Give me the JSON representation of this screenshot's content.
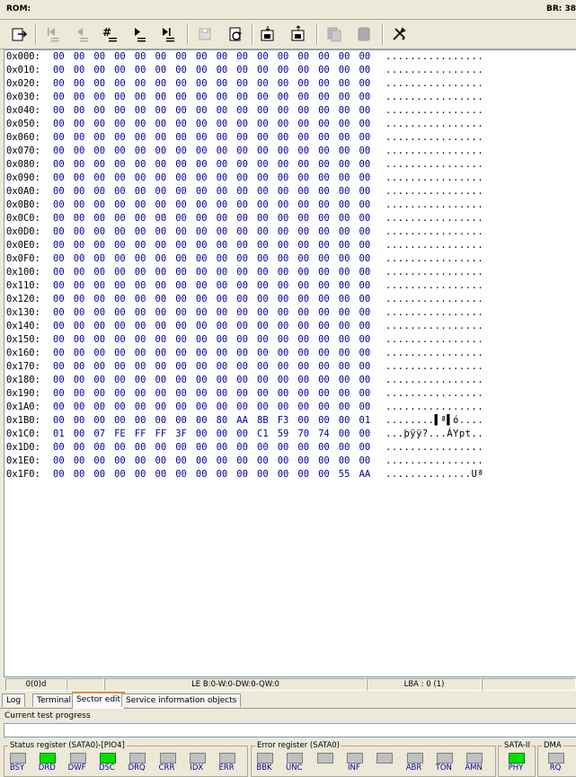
{
  "title_bar": {
    "rom_label": "ROM:",
    "br_label": "BR: 38"
  },
  "toolbar": {
    "buttons": [
      {
        "name": "export-icon",
        "enabled": true
      },
      {
        "name": "first-sector-icon",
        "enabled": false
      },
      {
        "name": "prev-sector-icon",
        "enabled": false
      },
      {
        "name": "goto-sector-icon",
        "enabled": true
      },
      {
        "name": "next-sector-icon",
        "enabled": true
      },
      {
        "name": "last-sector-icon",
        "enabled": true
      },
      {
        "name": "save-icon",
        "enabled": false
      },
      {
        "name": "refresh-icon",
        "enabled": true
      },
      {
        "name": "load-file-icon",
        "enabled": true
      },
      {
        "name": "save-file-icon",
        "enabled": true
      },
      {
        "name": "copy-icon",
        "enabled": false
      },
      {
        "name": "paste-icon",
        "enabled": false
      },
      {
        "name": "tools-icon",
        "enabled": true
      }
    ]
  },
  "hex_rows": [
    {
      "addr": "0x000:",
      "bytes": [
        "00",
        "00",
        "00",
        "00",
        "00",
        "00",
        "00",
        "00",
        "00",
        "00",
        "00",
        "00",
        "00",
        "00",
        "00",
        "00"
      ],
      "ascii": "................"
    },
    {
      "addr": "0x010:",
      "bytes": [
        "00",
        "00",
        "00",
        "00",
        "00",
        "00",
        "00",
        "00",
        "00",
        "00",
        "00",
        "00",
        "00",
        "00",
        "00",
        "00"
      ],
      "ascii": "................"
    },
    {
      "addr": "0x020:",
      "bytes": [
        "00",
        "00",
        "00",
        "00",
        "00",
        "00",
        "00",
        "00",
        "00",
        "00",
        "00",
        "00",
        "00",
        "00",
        "00",
        "00"
      ],
      "ascii": "................"
    },
    {
      "addr": "0x030:",
      "bytes": [
        "00",
        "00",
        "00",
        "00",
        "00",
        "00",
        "00",
        "00",
        "00",
        "00",
        "00",
        "00",
        "00",
        "00",
        "00",
        "00"
      ],
      "ascii": "................"
    },
    {
      "addr": "0x040:",
      "bytes": [
        "00",
        "00",
        "00",
        "00",
        "00",
        "00",
        "00",
        "00",
        "00",
        "00",
        "00",
        "00",
        "00",
        "00",
        "00",
        "00"
      ],
      "ascii": "................"
    },
    {
      "addr": "0x050:",
      "bytes": [
        "00",
        "00",
        "00",
        "00",
        "00",
        "00",
        "00",
        "00",
        "00",
        "00",
        "00",
        "00",
        "00",
        "00",
        "00",
        "00"
      ],
      "ascii": "................"
    },
    {
      "addr": "0x060:",
      "bytes": [
        "00",
        "00",
        "00",
        "00",
        "00",
        "00",
        "00",
        "00",
        "00",
        "00",
        "00",
        "00",
        "00",
        "00",
        "00",
        "00"
      ],
      "ascii": "................"
    },
    {
      "addr": "0x070:",
      "bytes": [
        "00",
        "00",
        "00",
        "00",
        "00",
        "00",
        "00",
        "00",
        "00",
        "00",
        "00",
        "00",
        "00",
        "00",
        "00",
        "00"
      ],
      "ascii": "................"
    },
    {
      "addr": "0x080:",
      "bytes": [
        "00",
        "00",
        "00",
        "00",
        "00",
        "00",
        "00",
        "00",
        "00",
        "00",
        "00",
        "00",
        "00",
        "00",
        "00",
        "00"
      ],
      "ascii": "................"
    },
    {
      "addr": "0x090:",
      "bytes": [
        "00",
        "00",
        "00",
        "00",
        "00",
        "00",
        "00",
        "00",
        "00",
        "00",
        "00",
        "00",
        "00",
        "00",
        "00",
        "00"
      ],
      "ascii": "................"
    },
    {
      "addr": "0x0A0:",
      "bytes": [
        "00",
        "00",
        "00",
        "00",
        "00",
        "00",
        "00",
        "00",
        "00",
        "00",
        "00",
        "00",
        "00",
        "00",
        "00",
        "00"
      ],
      "ascii": "................"
    },
    {
      "addr": "0x0B0:",
      "bytes": [
        "00",
        "00",
        "00",
        "00",
        "00",
        "00",
        "00",
        "00",
        "00",
        "00",
        "00",
        "00",
        "00",
        "00",
        "00",
        "00"
      ],
      "ascii": "................"
    },
    {
      "addr": "0x0C0:",
      "bytes": [
        "00",
        "00",
        "00",
        "00",
        "00",
        "00",
        "00",
        "00",
        "00",
        "00",
        "00",
        "00",
        "00",
        "00",
        "00",
        "00"
      ],
      "ascii": "................"
    },
    {
      "addr": "0x0D0:",
      "bytes": [
        "00",
        "00",
        "00",
        "00",
        "00",
        "00",
        "00",
        "00",
        "00",
        "00",
        "00",
        "00",
        "00",
        "00",
        "00",
        "00"
      ],
      "ascii": "................"
    },
    {
      "addr": "0x0E0:",
      "bytes": [
        "00",
        "00",
        "00",
        "00",
        "00",
        "00",
        "00",
        "00",
        "00",
        "00",
        "00",
        "00",
        "00",
        "00",
        "00",
        "00"
      ],
      "ascii": "................"
    },
    {
      "addr": "0x0F0:",
      "bytes": [
        "00",
        "00",
        "00",
        "00",
        "00",
        "00",
        "00",
        "00",
        "00",
        "00",
        "00",
        "00",
        "00",
        "00",
        "00",
        "00"
      ],
      "ascii": "................"
    },
    {
      "addr": "0x100:",
      "bytes": [
        "00",
        "00",
        "00",
        "00",
        "00",
        "00",
        "00",
        "00",
        "00",
        "00",
        "00",
        "00",
        "00",
        "00",
        "00",
        "00"
      ],
      "ascii": "................"
    },
    {
      "addr": "0x110:",
      "bytes": [
        "00",
        "00",
        "00",
        "00",
        "00",
        "00",
        "00",
        "00",
        "00",
        "00",
        "00",
        "00",
        "00",
        "00",
        "00",
        "00"
      ],
      "ascii": "................"
    },
    {
      "addr": "0x120:",
      "bytes": [
        "00",
        "00",
        "00",
        "00",
        "00",
        "00",
        "00",
        "00",
        "00",
        "00",
        "00",
        "00",
        "00",
        "00",
        "00",
        "00"
      ],
      "ascii": "................"
    },
    {
      "addr": "0x130:",
      "bytes": [
        "00",
        "00",
        "00",
        "00",
        "00",
        "00",
        "00",
        "00",
        "00",
        "00",
        "00",
        "00",
        "00",
        "00",
        "00",
        "00"
      ],
      "ascii": "................"
    },
    {
      "addr": "0x140:",
      "bytes": [
        "00",
        "00",
        "00",
        "00",
        "00",
        "00",
        "00",
        "00",
        "00",
        "00",
        "00",
        "00",
        "00",
        "00",
        "00",
        "00"
      ],
      "ascii": "................"
    },
    {
      "addr": "0x150:",
      "bytes": [
        "00",
        "00",
        "00",
        "00",
        "00",
        "00",
        "00",
        "00",
        "00",
        "00",
        "00",
        "00",
        "00",
        "00",
        "00",
        "00"
      ],
      "ascii": "................"
    },
    {
      "addr": "0x160:",
      "bytes": [
        "00",
        "00",
        "00",
        "00",
        "00",
        "00",
        "00",
        "00",
        "00",
        "00",
        "00",
        "00",
        "00",
        "00",
        "00",
        "00"
      ],
      "ascii": "................"
    },
    {
      "addr": "0x170:",
      "bytes": [
        "00",
        "00",
        "00",
        "00",
        "00",
        "00",
        "00",
        "00",
        "00",
        "00",
        "00",
        "00",
        "00",
        "00",
        "00",
        "00"
      ],
      "ascii": "................"
    },
    {
      "addr": "0x180:",
      "bytes": [
        "00",
        "00",
        "00",
        "00",
        "00",
        "00",
        "00",
        "00",
        "00",
        "00",
        "00",
        "00",
        "00",
        "00",
        "00",
        "00"
      ],
      "ascii": "................"
    },
    {
      "addr": "0x190:",
      "bytes": [
        "00",
        "00",
        "00",
        "00",
        "00",
        "00",
        "00",
        "00",
        "00",
        "00",
        "00",
        "00",
        "00",
        "00",
        "00",
        "00"
      ],
      "ascii": "................"
    },
    {
      "addr": "0x1A0:",
      "bytes": [
        "00",
        "00",
        "00",
        "00",
        "00",
        "00",
        "00",
        "00",
        "00",
        "00",
        "00",
        "00",
        "00",
        "00",
        "00",
        "00"
      ],
      "ascii": "................"
    },
    {
      "addr": "0x1B0:",
      "bytes": [
        "00",
        "00",
        "00",
        "00",
        "00",
        "00",
        "00",
        "00",
        "80",
        "AA",
        "8B",
        "F3",
        "00",
        "00",
        "00",
        "01"
      ],
      "ascii": "........▌ª▌ó...."
    },
    {
      "addr": "0x1C0:",
      "bytes": [
        "01",
        "00",
        "07",
        "FE",
        "FF",
        "FF",
        "3F",
        "00",
        "00",
        "00",
        "C1",
        "59",
        "70",
        "74",
        "00",
        "00"
      ],
      "ascii": "...þÿÿ?...ÁYpt.."
    },
    {
      "addr": "0x1D0:",
      "bytes": [
        "00",
        "00",
        "00",
        "00",
        "00",
        "00",
        "00",
        "00",
        "00",
        "00",
        "00",
        "00",
        "00",
        "00",
        "00",
        "00"
      ],
      "ascii": "................"
    },
    {
      "addr": "0x1E0:",
      "bytes": [
        "00",
        "00",
        "00",
        "00",
        "00",
        "00",
        "00",
        "00",
        "00",
        "00",
        "00",
        "00",
        "00",
        "00",
        "00",
        "00"
      ],
      "ascii": "................"
    },
    {
      "addr": "0x1F0:",
      "bytes": [
        "00",
        "00",
        "00",
        "00",
        "00",
        "00",
        "00",
        "00",
        "00",
        "00",
        "00",
        "00",
        "00",
        "00",
        "55",
        "AA"
      ],
      "ascii": "..............Uª"
    }
  ],
  "status_strip": {
    "offset": "0(0)d",
    "empty1": "",
    "word_view": "LE B:0-W:0-DW:0-QW:0",
    "lba": "LBA : 0 (1)",
    "empty2": ""
  },
  "tabs": [
    {
      "label": "Log",
      "active": false
    },
    {
      "label": "Terminal",
      "active": false
    },
    {
      "label": "Sector edit",
      "active": true
    },
    {
      "label": "Service information objects",
      "active": false
    }
  ],
  "progress": {
    "label": "Current test progress",
    "value": 0
  },
  "status_register": {
    "title": "Status register (SATA0)-[PIO4]",
    "leds": [
      {
        "label": "BSY",
        "on": false
      },
      {
        "label": "DRD",
        "on": true
      },
      {
        "label": "DWF",
        "on": false
      },
      {
        "label": "DSC",
        "on": true
      },
      {
        "label": "DRQ",
        "on": false
      },
      {
        "label": "CRR",
        "on": false
      },
      {
        "label": "IDX",
        "on": false
      },
      {
        "label": "ERR",
        "on": false
      }
    ]
  },
  "error_register": {
    "title": "Error register (SATA0)",
    "leds": [
      {
        "label": "BBK",
        "on": false
      },
      {
        "label": "UNC",
        "on": false
      },
      {
        "label": "",
        "on": false
      },
      {
        "label": "INF",
        "on": false
      },
      {
        "label": "",
        "on": false
      },
      {
        "label": "ABR",
        "on": false
      },
      {
        "label": "TON",
        "on": false
      },
      {
        "label": "AMN",
        "on": false
      }
    ]
  },
  "sata_ii": {
    "title": "SATA-II",
    "leds": [
      {
        "label": "PHY",
        "on": true
      }
    ]
  },
  "dma": {
    "title": "DMA",
    "leds": [
      {
        "label": "RQ",
        "on": false
      }
    ]
  }
}
